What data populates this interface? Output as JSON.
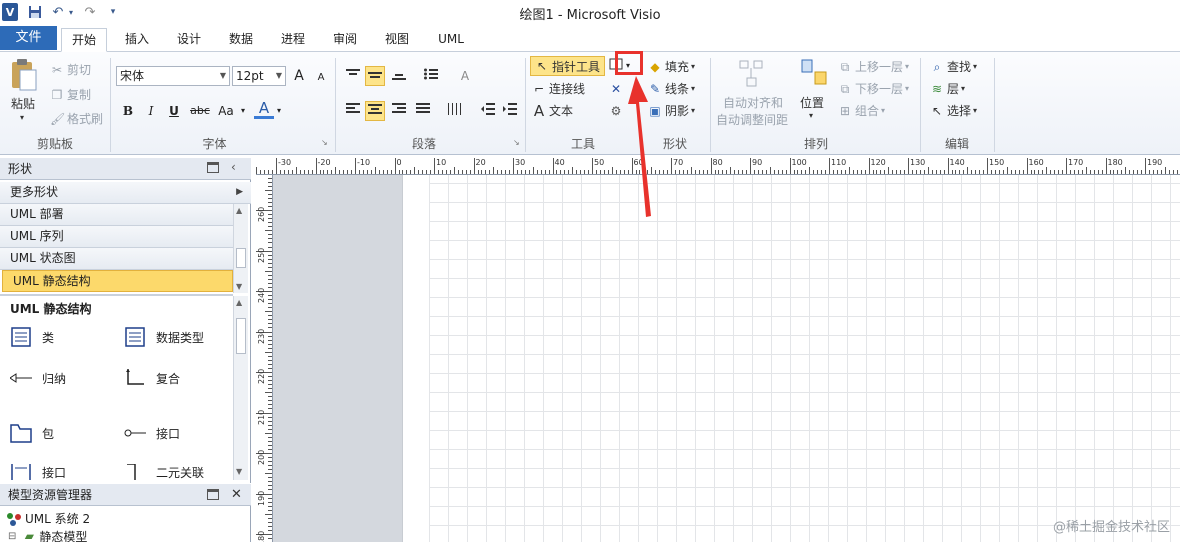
{
  "window": {
    "title": "绘图1  -  Microsoft Visio",
    "app_icon": "V"
  },
  "tabs": [
    "文件",
    "开始",
    "插入",
    "设计",
    "数据",
    "进程",
    "审阅",
    "视图",
    "UML"
  ],
  "clipboard": {
    "paste": "粘贴",
    "cut": "剪切",
    "copy": "复制",
    "format_painter": "格式刷",
    "label": "剪贴板"
  },
  "font": {
    "name": "宋体",
    "size": "12pt",
    "grow": "A",
    "shrink": "A",
    "bold": "B",
    "italic": "I",
    "underline": "U",
    "strike": "abc",
    "case": "Aa",
    "color": "A",
    "label": "字体"
  },
  "paragraph": {
    "label": "段落"
  },
  "tools": {
    "pointer": "指针工具",
    "connector": "连接线",
    "text": "文本",
    "label": "工具"
  },
  "shape_style": {
    "fill": "填充",
    "line": "线条",
    "shadow": "阴影",
    "label": "形状"
  },
  "arrange": {
    "auto_align": "自动对齐和",
    "auto_space": "自动调整间距",
    "position": "位置",
    "bring_forward": "上移一层",
    "send_backward": "下移一层",
    "group": "组合",
    "label": "排列"
  },
  "editing": {
    "find": "查找",
    "layers": "层",
    "select": "选择",
    "label": "编辑"
  },
  "shapes_pane": {
    "title": "形状",
    "more_shapes": "更多形状",
    "stencils": [
      "UML 部署",
      "UML 序列",
      "UML 状态图",
      "UML 静态结构"
    ],
    "active_stencil_title": "UML 静态结构",
    "items": [
      {
        "label": "类",
        "icon": "class-icon"
      },
      {
        "label": "数据类型",
        "icon": "datatype-icon"
      },
      {
        "label": "归纳",
        "icon": "generalization-icon"
      },
      {
        "label": "复合",
        "icon": "composition-icon"
      },
      {
        "label": "包",
        "icon": "package-icon"
      },
      {
        "label": "接口",
        "icon": "interface-lollipop-icon"
      },
      {
        "label": "接口",
        "icon": "interface-icon"
      },
      {
        "label": "二元关联",
        "icon": "binary-association-icon"
      }
    ]
  },
  "model_explorer": {
    "title": "模型资源管理器",
    "root": "UML 系统 2",
    "child": "静态模型"
  },
  "ruler_h": [
    "-30",
    "-20",
    "-10",
    "0",
    "10",
    "20",
    "30",
    "40",
    "50",
    "60",
    "70",
    "80",
    "90",
    "100",
    "110",
    "120",
    "130",
    "140",
    "150",
    "160",
    "170",
    "180",
    "190"
  ],
  "ruler_v": [
    "260",
    "250",
    "240",
    "230",
    "220",
    "210",
    "200",
    "190",
    "180"
  ],
  "watermark": "@稀土掘金技术社区",
  "colors": {
    "file_tab": "#2d6bb8",
    "highlight": "#fde48a",
    "annotation_red": "#e8322c"
  }
}
